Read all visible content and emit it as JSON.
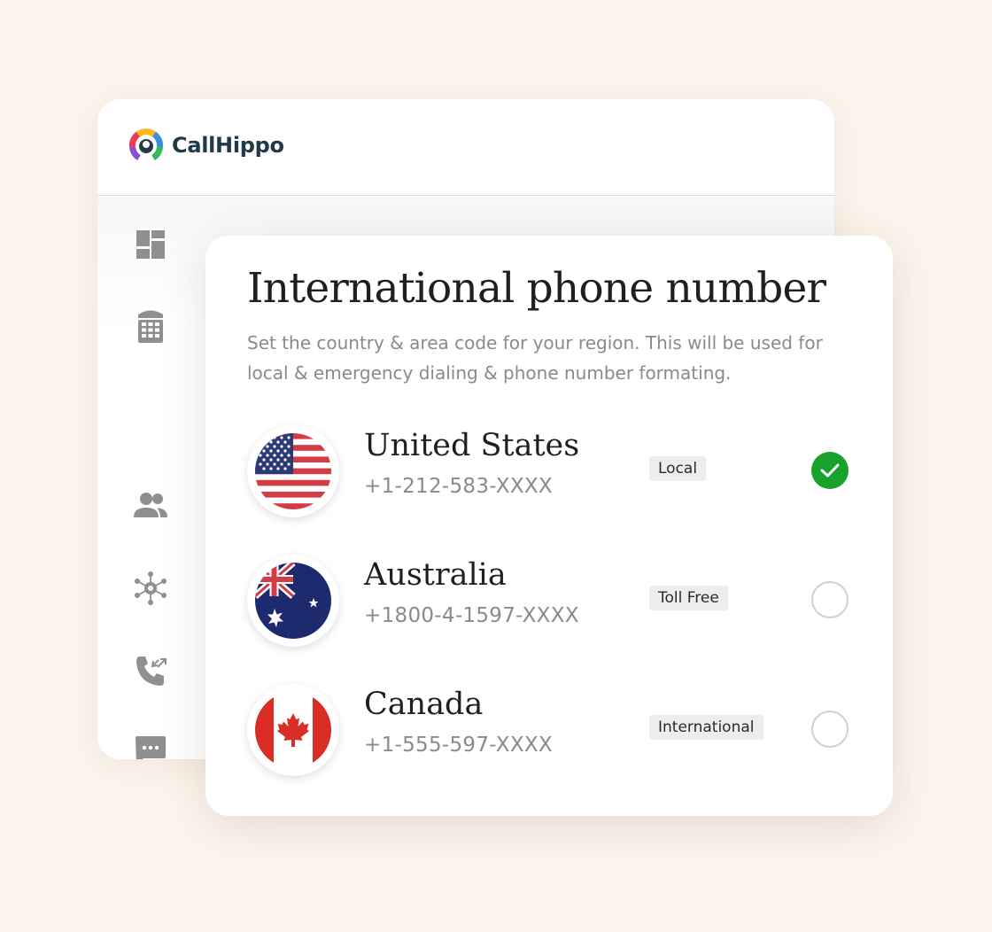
{
  "brand": {
    "name": "CallHippo"
  },
  "sidebar": {
    "icons": [
      "dashboard-icon",
      "dialpad-icon",
      "contacts-icon",
      "integrations-icon",
      "call-forwarding-icon",
      "messages-icon"
    ]
  },
  "panel": {
    "title": "International phone number",
    "description": "Set the country & area code for your region. This will be used for local & emergency dialing & phone number formating."
  },
  "countries": [
    {
      "name": "United States",
      "phone": "+1-212-583-XXXX",
      "type": "Local",
      "selected": true,
      "flag": "us-flag-icon"
    },
    {
      "name": "Australia",
      "phone": "+1800-4-1597-XXXX",
      "type": "Toll Free",
      "selected": false,
      "flag": "australia-flag-icon"
    },
    {
      "name": "Canada",
      "phone": "+1-555-597-XXXX",
      "type": "International",
      "selected": false,
      "flag": "canada-flag-icon"
    }
  ],
  "colors": {
    "background": "#fcf5ec",
    "selected": "#18a22c",
    "icon_gray": "#909090",
    "brand_text": "#213a49"
  }
}
